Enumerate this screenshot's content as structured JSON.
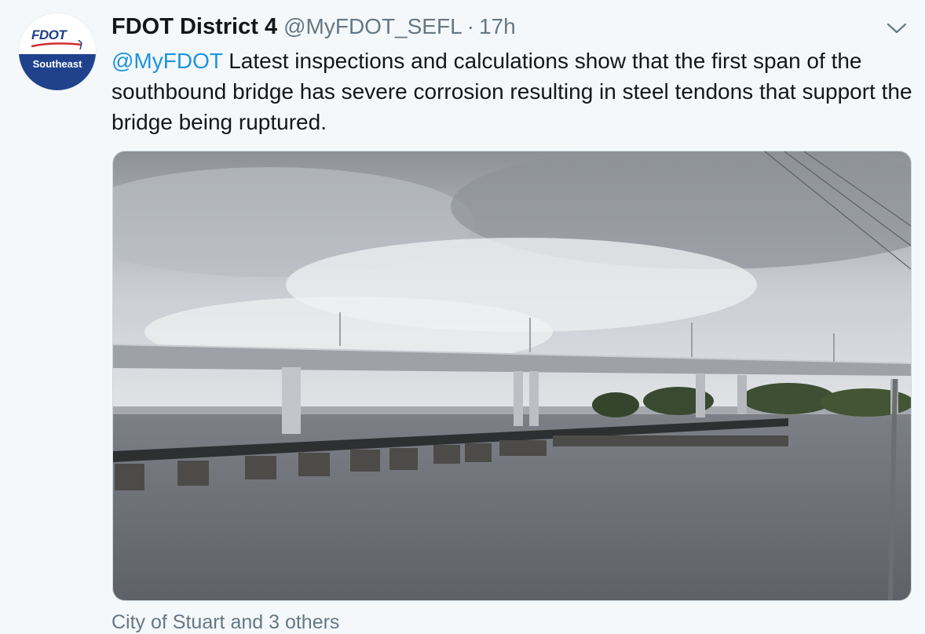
{
  "tweet": {
    "author": {
      "display_name": "FDOT District 4",
      "handle": "@MyFDOT_SEFL",
      "separator": "·",
      "timestamp": "17h",
      "avatar": {
        "logo_text": "FDOT",
        "region": "Southeast"
      }
    },
    "menu_icon": "chevron-down-icon",
    "body": {
      "mention": "@MyFDOT",
      "text": " Latest inspections and calculations show that the first span of the southbound bridge has severe corrosion resulting in steel tendons that support the bridge being ruptured."
    },
    "media_photo": "bridge-over-river-photo",
    "tagged_people": "City of Stuart and 3 others"
  },
  "colors": {
    "background": "#f5f8fa",
    "text_primary": "#14171a",
    "text_secondary": "#657786",
    "link": "#1b95e0",
    "avatar_blue": "#20428c"
  }
}
